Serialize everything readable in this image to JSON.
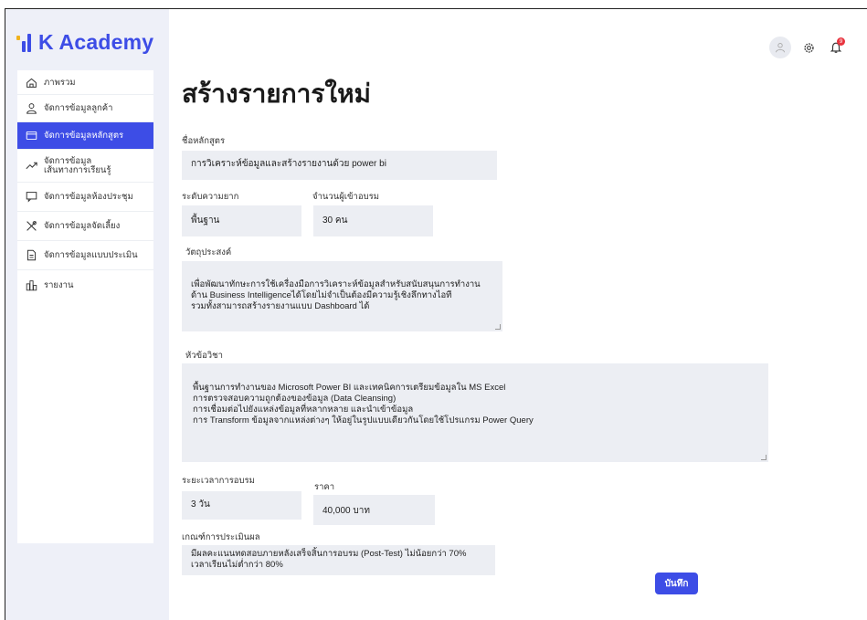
{
  "app": {
    "title": "K Academy"
  },
  "sidebar": {
    "items": [
      {
        "label": "ภาพรวม",
        "icon": "home-icon"
      },
      {
        "label": "จัดการข้อมูลลูกค้า",
        "icon": "user-icon"
      },
      {
        "label": "จัดการข้อมูลหลักสูตร",
        "icon": "folder-icon",
        "active": true
      },
      {
        "label": "จัดการข้อมูล\nเส้นทางการเรียนรู้",
        "icon": "trend-icon"
      },
      {
        "label": "จัดการข้อมูลห้องประชุม",
        "icon": "chat-icon"
      },
      {
        "label": "จัดการข้อมูลจัดเลี้ยง",
        "icon": "utensils-icon"
      },
      {
        "label": "จัดการข้อมูลแบบประเมิน",
        "icon": "document-icon"
      },
      {
        "label": "รายงาน",
        "icon": "report-icon"
      }
    ]
  },
  "header": {
    "notification_count": "9"
  },
  "main": {
    "title": "สร้างรายการใหม่",
    "course_name": {
      "label": "ชื่อหลักสูตร",
      "value": "การวิเคราะห์ข้อมูลและสร้างรายงานด้วย power bi"
    },
    "difficulty": {
      "label": "ระดับความยาก",
      "value": "พื้นฐาน"
    },
    "participants": {
      "label": "จำนวนผู้เข้าอบรม",
      "value": "30 คน"
    },
    "objective": {
      "label": "วัตถุประสงค์",
      "value": "เพื่อพัฒนาทักษะการใช้เครื่องมือการวิเคราะห์ข้อมูลสำหรับสนับสนุนการทำงาน\nด้าน Business Intelligenceได้โดยไม่จำเป็นต้องมีความรู้เชิงลึกทางไอที\nรวมทั้งสามารถสร้างรายงานแบบ Dashboard ได้"
    },
    "topics": {
      "label": "หัวข้อวิชา",
      "value": "พื้นฐานการทำงานของ Microsoft Power BI และเทคนิคการเตรียมข้อมูลใน MS Excel\nการตรวจสอบความถูกต้องของข้อมูล (Data Cleansing)\nการเชื่อมต่อไปยังแหล่งข้อมูลที่หลากหลาย และนำเข้าข้อมูล\nการ Transform ข้อมูลจากแหล่งต่างๆ ให้อยู่ในรูปแบบเดียวกันโดยใช้โปรแกรม Power Query"
    },
    "duration": {
      "label": "ระยะเวลาการอบรม",
      "value": "3 วัน"
    },
    "price": {
      "label": "ราคา",
      "value": "40,000 บาท"
    },
    "criteria": {
      "label": "เกณฑ์การประเมินผล",
      "value": "มีผลคะแนนทดสอบภายหลังเสร็จสิ้นการอบรม (Post-Test) ไม่น้อยกว่า 70%\nเวลาเรียนไม่ต่ำกว่า 80%"
    },
    "save_label": "บันทึก"
  }
}
